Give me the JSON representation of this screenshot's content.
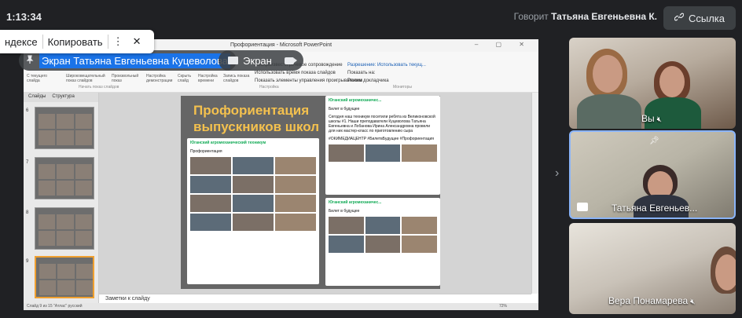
{
  "topbar": {
    "time": "1:13:34",
    "speaking_prefix": "Говорит",
    "speaking_name": "Татьяна Евгеньевна К.",
    "link_label": "Ссылка"
  },
  "popup": {
    "item1": "ндексе",
    "item2": "Копировать",
    "more": "⋮",
    "close": "✕"
  },
  "presenter": {
    "label": "Экран Татьяна Евгеньевна Куцеволова",
    "screen_label": "Экран"
  },
  "ppt": {
    "window_title": "Профориентация - Microsoft PowerPoint",
    "ribbon": {
      "groups": [
        "С текущего слайда",
        "Широковещательный показ слайдов",
        "Произвольный показ",
        "Настройка демонстрации",
        "Скрыть слайд",
        "Настройка времени",
        "Запись показа слайдов"
      ],
      "section_start": "Начать показ слайдов",
      "section_setup": "Настройка",
      "section_monitors": "Мониторы",
      "check_narration": "Воспроизвести речевое сопровождение",
      "check_timings": "Использовать время показа слайдов",
      "check_controls": "Показать элементы управления проигрывателем",
      "resolution": "Разрешение: Использовать текущ...",
      "show_on": "Показать на:",
      "presenter_mode": "Режим докладчика"
    },
    "side_tabs": [
      "Слайды",
      "Структура"
    ],
    "thumb_numbers": [
      "6",
      "7",
      "8",
      "9"
    ],
    "slide_title": "Профориентация выпускников школ",
    "post_left": {
      "org": "Юганский агромеханический техникум",
      "text": "Профориентация"
    },
    "post_right_top": {
      "org": "Юганский агромеханичес...",
      "text": "Билет в будущее",
      "body": "Сегодня наш техникум посетили ребята из Великоновской школы #1. Наши преподаватели Куцеволова Татьяна Евгеньевна и Лобанова Ирина Александровна провели для них мастер-класс по приготовлению сыра",
      "tags": "#ОКИМЕДИАЦЕНТР #БилетвБудущее #Профориентация"
    },
    "post_right_bottom": {
      "org": "Юганский агромеханичес...",
      "text": "Билет в будущее"
    },
    "notes": "Заметки к слайду",
    "status": "Слайд 9 из 15  \"Атлас\"  русский",
    "zoom": "72%"
  },
  "tiles": [
    {
      "name": "Вы"
    },
    {
      "name": "Татьяна Евгеньев..."
    },
    {
      "name": "Вера Понамарева"
    }
  ],
  "colors": {
    "background": "#202124",
    "presenter_highlight": "#1a73e8",
    "active_tile_border": "#8ab4f8",
    "slide_title": "#f4c14e"
  },
  "icons": {
    "link": "link-icon",
    "pin": "pin-icon",
    "screen": "screen-share-icon",
    "camera": "camera-icon",
    "mic_off": "mic-off-icon",
    "chevron": "chevron-right-icon"
  }
}
